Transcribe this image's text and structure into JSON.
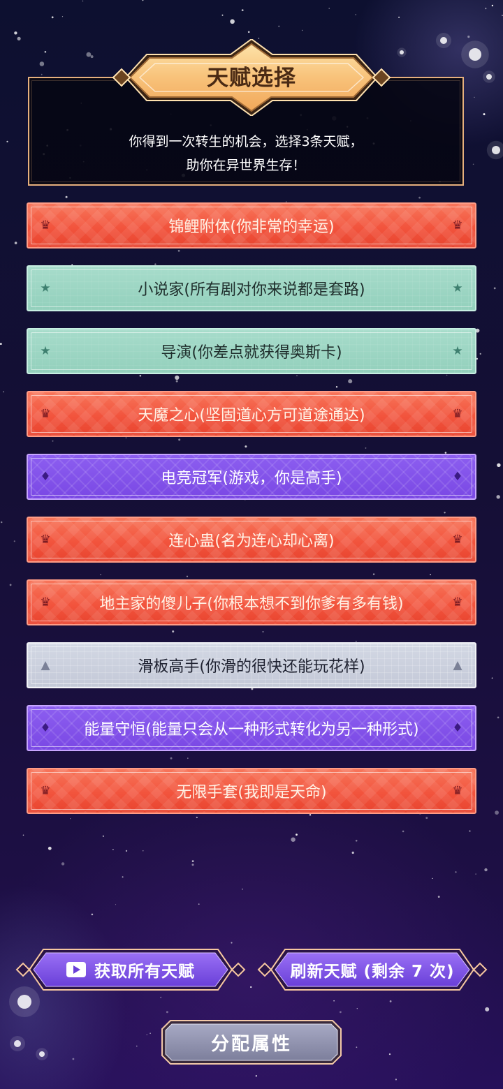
{
  "header": {
    "title": "天赋选择",
    "description_line1": "你得到一次转生的机会，选择3条天赋，",
    "description_line2": "助你在异世界生存！"
  },
  "talents": [
    {
      "label": "锦鲤附体(你非常的幸运)",
      "rarity": "orange",
      "icon": "crown-icon"
    },
    {
      "label": "小说家(所有剧对你来说都是套路)",
      "rarity": "teal",
      "icon": "star-icon"
    },
    {
      "label": "导演(你差点就获得奥斯卡)",
      "rarity": "teal",
      "icon": "star-icon"
    },
    {
      "label": "天魔之心(坚固道心方可道途通达)",
      "rarity": "orange",
      "icon": "crown-icon"
    },
    {
      "label": "电竞冠军(游戏，你是高手)",
      "rarity": "purple",
      "icon": "diamond-icon"
    },
    {
      "label": "连心蛊(名为连心却心离)",
      "rarity": "orange",
      "icon": "crown-icon"
    },
    {
      "label": "地主家的傻儿子(你根本想不到你爹有多有钱)",
      "rarity": "orange",
      "icon": "crown-icon"
    },
    {
      "label": "滑板高手(你滑的很快还能玩花样)",
      "rarity": "gray",
      "icon": "triangle-icon"
    },
    {
      "label": "能量守恒(能量只会从一种形式转化为另一种形式)",
      "rarity": "purple",
      "icon": "diamond-icon"
    },
    {
      "label": "无限手套(我即是天命)",
      "rarity": "orange",
      "icon": "crown-icon"
    }
  ],
  "buttons": {
    "get_all": "获取所有天赋",
    "refresh": "刷新天赋 (剩余 7 次)",
    "assign": "分配属性"
  },
  "colors": {
    "orange": "#f2543d",
    "teal": "#93d0bc",
    "purple": "#7a48e4",
    "gray": "#c4c9d8",
    "gold": "#f8c27a"
  }
}
